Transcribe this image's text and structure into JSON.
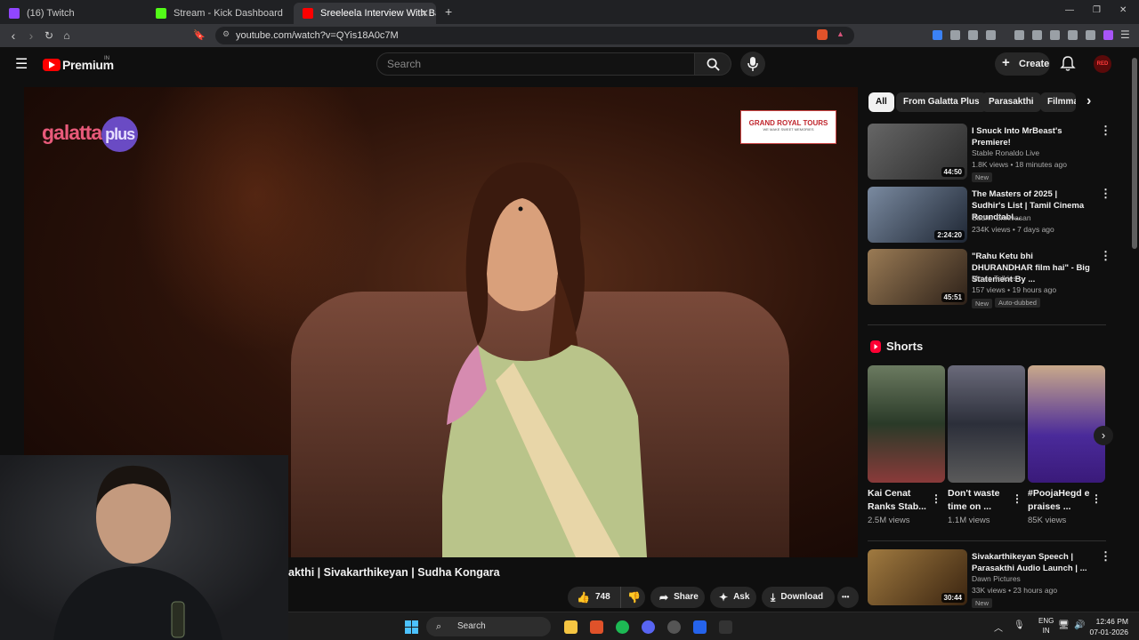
{
  "browser": {
    "tabs": [
      {
        "label": "(16) Twitch",
        "favicon_color": "#9146ff"
      },
      {
        "label": "Stream - Kick Dashboard",
        "favicon_color": "#53fc18"
      },
      {
        "label": "Sreeleela Interview With Baradw",
        "favicon_color": "#ff0000",
        "active": true
      }
    ],
    "new_tab": "+",
    "url": "youtube.com/watch?v=QYis18A0c7M",
    "window_controls": [
      "—",
      "❐",
      "✕"
    ]
  },
  "youtube": {
    "logo_text": "Premium",
    "region": "IN",
    "search_placeholder": "Search",
    "create_label": "Create",
    "avatar_text": "RED"
  },
  "video": {
    "title": "akthi | Sivakarthikeyan | Sudha Kongara",
    "channel_watermark": "galatta",
    "channel_watermark_2": "plus",
    "sponsor": "GRAND ROYAL TOURS",
    "sponsor_tag": "WE MAKE SWEET MEMORIES",
    "actions": {
      "likes": "748",
      "share": "Share",
      "ask": "Ask",
      "download": "Download",
      "more": "•••"
    }
  },
  "chips": [
    "All",
    "From Galatta Plus",
    "Parasakthi",
    "Filmma"
  ],
  "recommendations": [
    {
      "title": "I Snuck Into MrBeast's Premiere!",
      "channel": "Stable Ronaldo Live",
      "meta": "1.8K views • 18 minutes ago",
      "badge": "New",
      "duration": "44:50",
      "thumb": "#4a4a4a"
    },
    {
      "title": "The Masters of 2025 | Sudhir's List | Tamil Cinema Roundtabl...",
      "channel": "Sudhir Srinivasan",
      "meta": "234K views • 7 days ago",
      "badge": "",
      "duration": "2:24:20",
      "thumb": "#3b4a5c"
    },
    {
      "title": "\"Rahu Ketu bhi DHURANDHAR film hai\" - Big Statement By ...",
      "channel": "Movie Talkies",
      "meta": "157 views • 19 hours ago",
      "badge": "New",
      "badge2": "Auto-dubbed",
      "duration": "45:51",
      "thumb": "#5a4b3a"
    }
  ],
  "shorts": {
    "heading": "Shorts",
    "items": [
      {
        "title": "Kai Cenat Ranks Stab...",
        "views": "2.5M views",
        "thumb": "#3e5b3a"
      },
      {
        "title": "Don't waste time on ...",
        "views": "1.1M views",
        "thumb": "#45485a"
      },
      {
        "title": "#PoojaHegd e praises ...",
        "views": "85K views",
        "thumb": "#5a3aa8"
      }
    ]
  },
  "recommendations_2": [
    {
      "title": "Sivakarthikeyan Speech | Parasakthi Audio Launch | ...",
      "channel": "Dawn Pictures",
      "meta": "33K views • 23 hours ago",
      "badge": "New",
      "duration": "30:44",
      "thumb": "#6b5230"
    }
  ],
  "taskbar": {
    "search": "Search",
    "lang_1": "ENG",
    "lang_2": "IN",
    "time": "12:46 PM",
    "date": "07-01-2026"
  }
}
